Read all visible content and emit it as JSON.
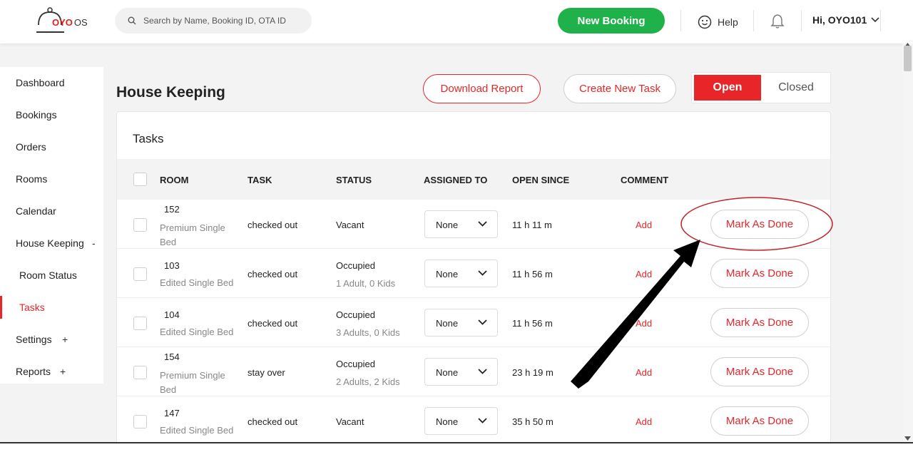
{
  "brand": {
    "logo_main": "OYO",
    "logo_suffix": "OS"
  },
  "header": {
    "search_placeholder": "Search by Name, Booking ID, OTA ID",
    "new_booking_label": "New Booking",
    "help_label": "Help",
    "user_label": "Hi, OYO101"
  },
  "sidebar": {
    "items": [
      {
        "label": "Dashboard"
      },
      {
        "label": "Bookings"
      },
      {
        "label": "Orders"
      },
      {
        "label": "Rooms"
      },
      {
        "label": "Calendar"
      },
      {
        "label": "House Keeping",
        "sign": "-"
      },
      {
        "label": "Room Status"
      },
      {
        "label": "Tasks"
      },
      {
        "label": "Settings",
        "sign": "+"
      },
      {
        "label": "Reports",
        "sign": "+"
      }
    ]
  },
  "page": {
    "title": "House Keeping",
    "download_label": "Download Report",
    "create_label": "Create New Task",
    "toggle_open": "Open",
    "toggle_closed": "Closed",
    "card_title": "Tasks"
  },
  "table": {
    "columns": [
      "ROOM",
      "TASK",
      "STATUS",
      "ASSIGNED TO",
      "OPEN SINCE",
      "COMMENT"
    ],
    "rows": [
      {
        "room": "152",
        "room_type": "Premium Single Bed",
        "task": "checked out",
        "status": "Vacant",
        "status_detail": "",
        "assigned": "None",
        "open_since": "11 h 11 m",
        "comment": "Add",
        "action": "Mark As Done"
      },
      {
        "room": "103",
        "room_type": "Edited Single Bed",
        "task": "checked out",
        "status": "Occupied",
        "status_detail": "1 Adult, 0 Kids",
        "assigned": "None",
        "open_since": "11 h 56 m",
        "comment": "Add",
        "action": "Mark As Done"
      },
      {
        "room": "104",
        "room_type": "Edited Single Bed",
        "task": "checked out",
        "status": "Occupied",
        "status_detail": "3 Adults, 0 Kids",
        "assigned": "None",
        "open_since": "11 h 56 m",
        "comment": "Add",
        "action": "Mark As Done"
      },
      {
        "room": "154",
        "room_type": "Premium Single Bed",
        "task": "stay over",
        "status": "Occupied",
        "status_detail": "2 Adults, 2 Kids",
        "assigned": "None",
        "open_since": "23 h 19 m",
        "comment": "Add",
        "action": "Mark As Done"
      },
      {
        "room": "147",
        "room_type": "Edited Single Bed",
        "task": "checked out",
        "status": "Vacant",
        "status_detail": "",
        "assigned": "None",
        "open_since": "35 h 50 m",
        "comment": "Add",
        "action": "Mark As Done"
      }
    ]
  },
  "colors": {
    "accent_red": "#e8262a",
    "brand_green": "#1fb24a",
    "annotation": "#c0272d"
  }
}
